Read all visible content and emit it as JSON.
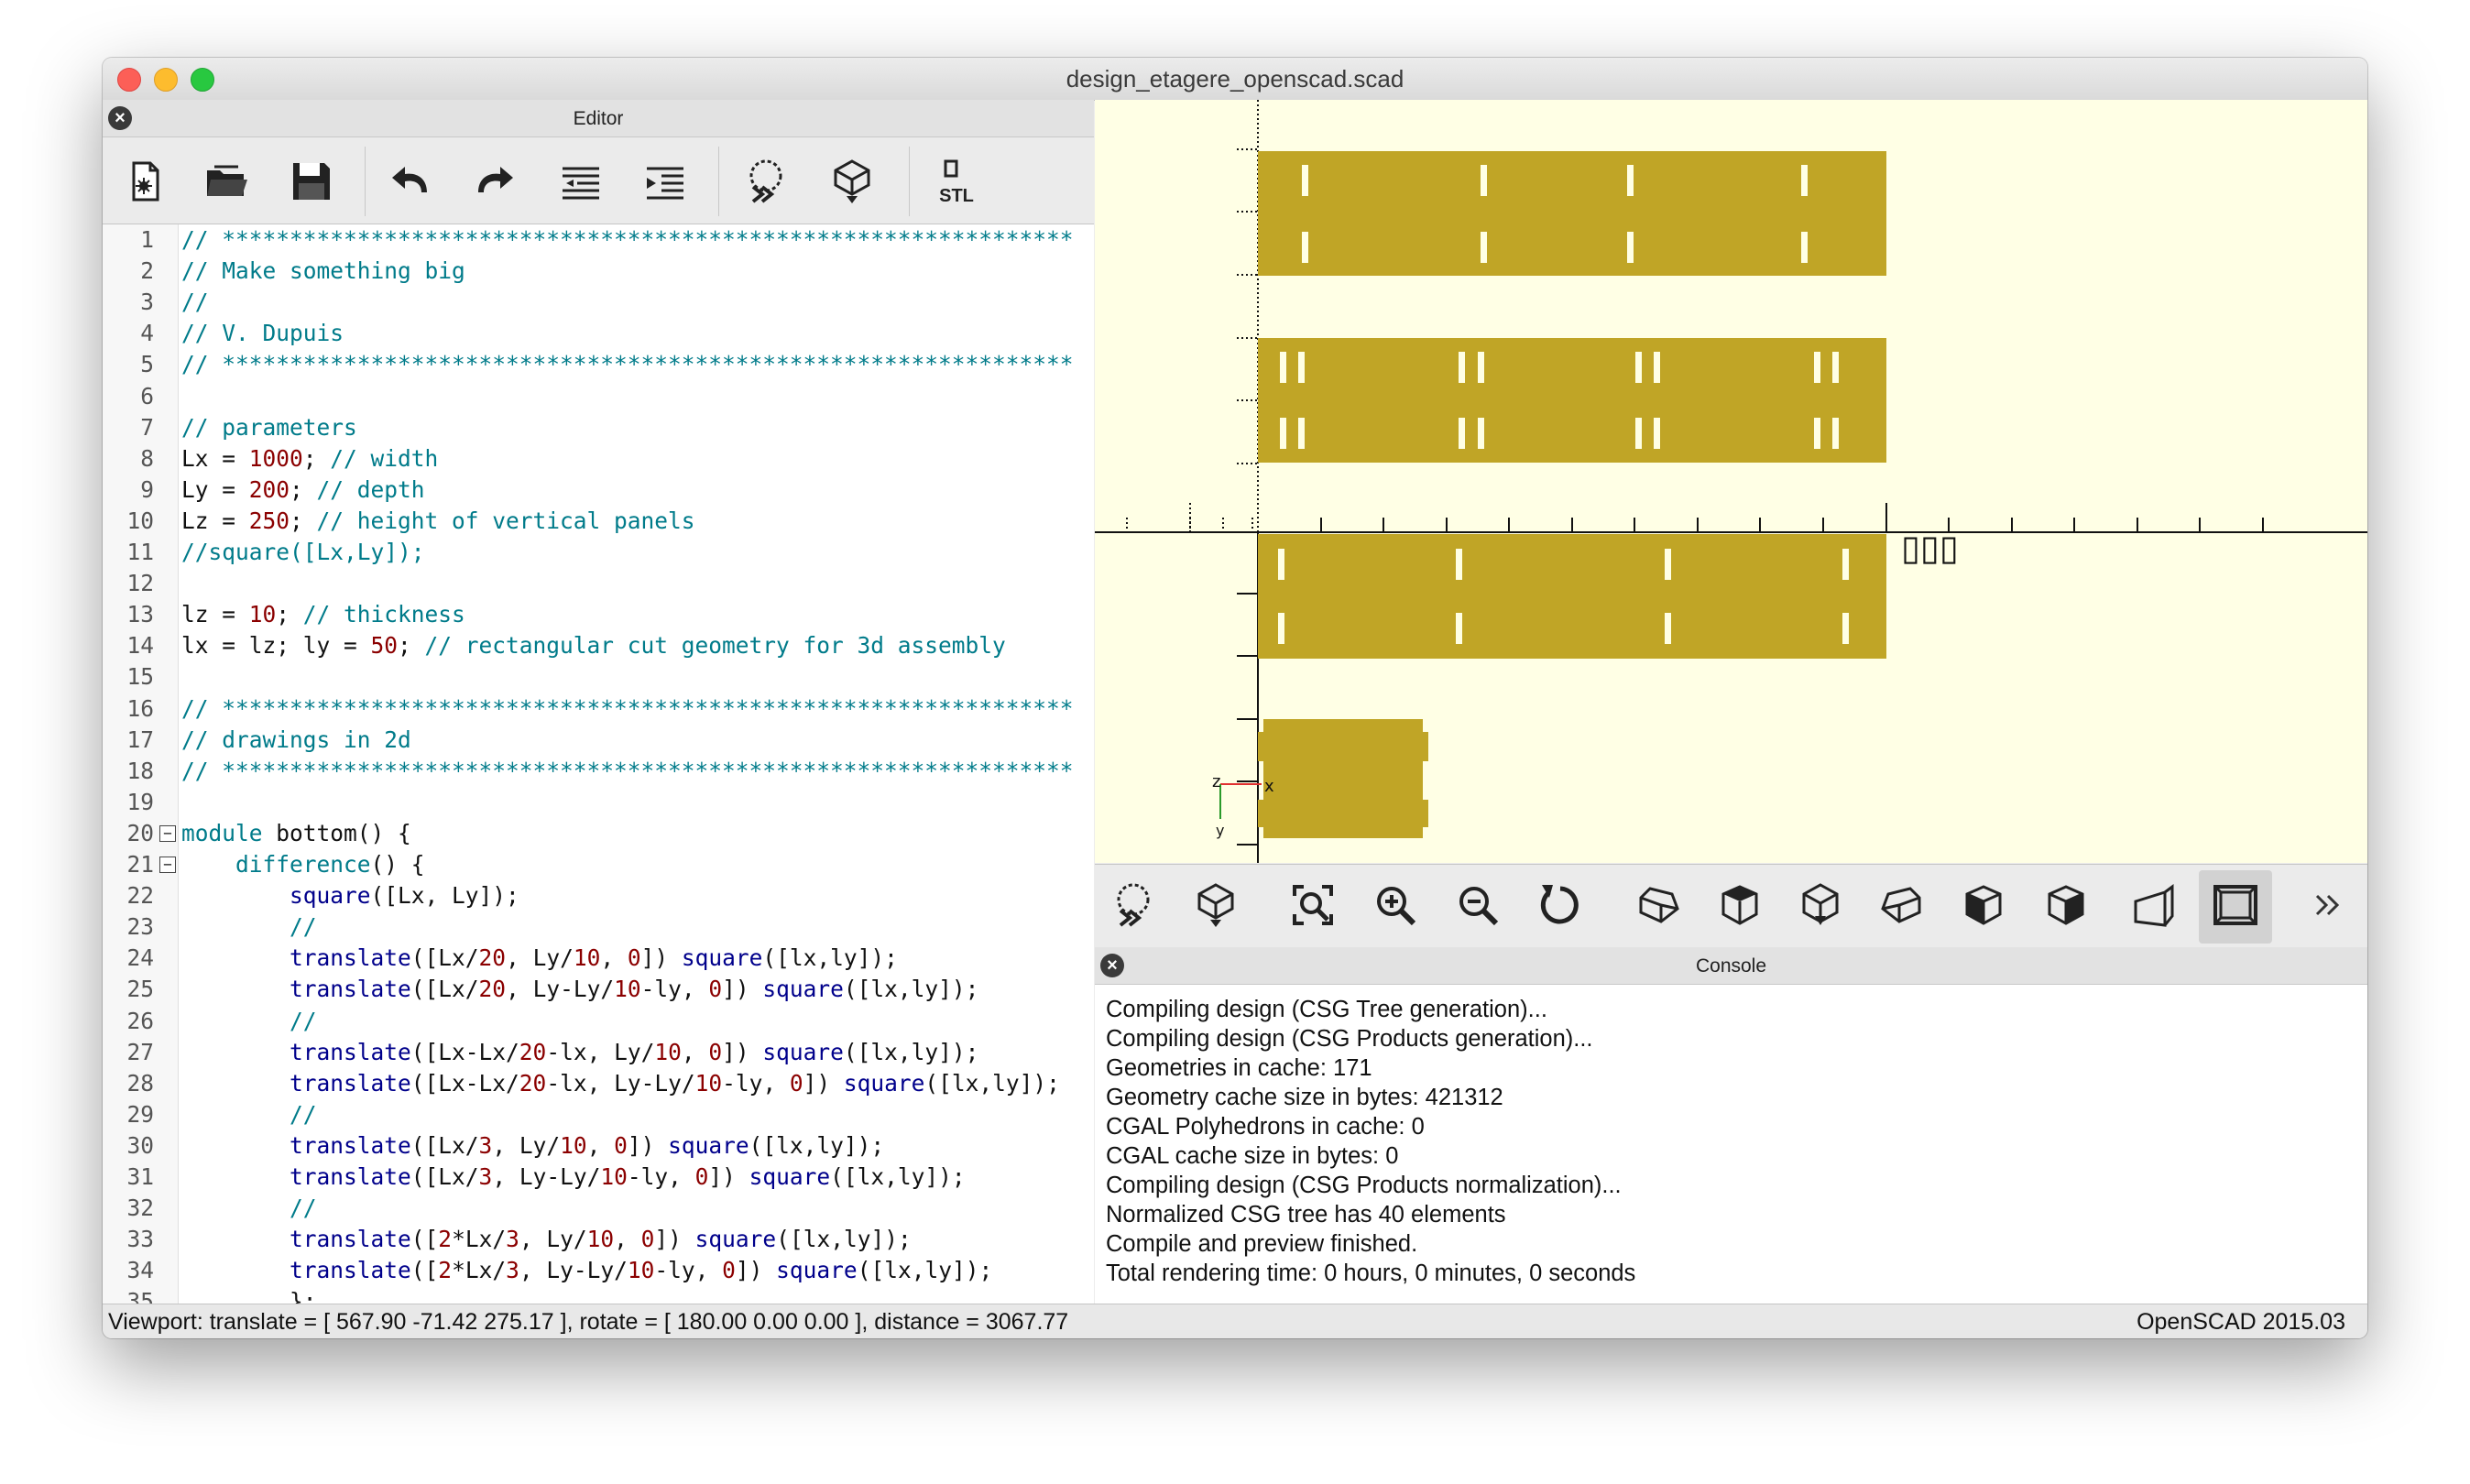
{
  "window": {
    "title": "design_etagere_openscad.scad"
  },
  "editor": {
    "title": "Editor",
    "toolbar": [
      "new-file-icon",
      "open-file-icon",
      "save-icon",
      "undo-icon",
      "redo-icon",
      "unindent-icon",
      "indent-icon",
      "preview-icon",
      "render-icon",
      "export-stl-icon"
    ],
    "stl_label": "STL",
    "lines": [
      {
        "n": "1",
        "parts": [
          [
            "com",
            "// ***************************************************************"
          ]
        ]
      },
      {
        "n": "2",
        "parts": [
          [
            "com",
            "// Make something big"
          ]
        ]
      },
      {
        "n": "3",
        "parts": [
          [
            "com",
            "//"
          ]
        ]
      },
      {
        "n": "4",
        "parts": [
          [
            "com",
            "// V. Dupuis"
          ]
        ]
      },
      {
        "n": "5",
        "parts": [
          [
            "com",
            "// ***************************************************************"
          ]
        ]
      },
      {
        "n": "6",
        "parts": []
      },
      {
        "n": "7",
        "parts": [
          [
            "com",
            "// parameters"
          ]
        ]
      },
      {
        "n": "8",
        "parts": [
          [
            "id",
            "Lx = "
          ],
          [
            "num",
            "1000"
          ],
          [
            "id",
            "; "
          ],
          [
            "com",
            "// width"
          ]
        ]
      },
      {
        "n": "9",
        "parts": [
          [
            "id",
            "Ly = "
          ],
          [
            "num",
            "200"
          ],
          [
            "id",
            "; "
          ],
          [
            "com",
            "// depth"
          ]
        ]
      },
      {
        "n": "10",
        "parts": [
          [
            "id",
            "Lz = "
          ],
          [
            "num",
            "250"
          ],
          [
            "id",
            "; "
          ],
          [
            "com",
            "// height of vertical panels"
          ]
        ]
      },
      {
        "n": "11",
        "parts": [
          [
            "com",
            "//square([Lx,Ly]);"
          ]
        ]
      },
      {
        "n": "12",
        "parts": []
      },
      {
        "n": "13",
        "parts": [
          [
            "id",
            "lz = "
          ],
          [
            "num",
            "10"
          ],
          [
            "id",
            "; "
          ],
          [
            "com",
            "// thickness"
          ]
        ]
      },
      {
        "n": "14",
        "parts": [
          [
            "id",
            "lx = lz; ly = "
          ],
          [
            "num",
            "50"
          ],
          [
            "id",
            "; "
          ],
          [
            "com",
            "// rectangular cut geometry for 3d assembly"
          ]
        ]
      },
      {
        "n": "15",
        "parts": []
      },
      {
        "n": "16",
        "parts": [
          [
            "com",
            "// ***************************************************************"
          ]
        ]
      },
      {
        "n": "17",
        "parts": [
          [
            "com",
            "// drawings in 2d"
          ]
        ]
      },
      {
        "n": "18",
        "parts": [
          [
            "com",
            "// ***************************************************************"
          ]
        ]
      },
      {
        "n": "19",
        "parts": []
      },
      {
        "n": "20",
        "fold": "−",
        "parts": [
          [
            "com",
            "module"
          ],
          [
            "id",
            " bottom() {"
          ]
        ]
      },
      {
        "n": "21",
        "fold": "−",
        "parts": [
          [
            "id",
            "    "
          ],
          [
            "com",
            "difference"
          ],
          [
            "id",
            "() {"
          ]
        ]
      },
      {
        "n": "22",
        "parts": [
          [
            "id",
            "        "
          ],
          [
            "fn",
            "square"
          ],
          [
            "id",
            "([Lx, Ly]);"
          ]
        ]
      },
      {
        "n": "23",
        "parts": [
          [
            "id",
            "        "
          ],
          [
            "com",
            "//"
          ]
        ]
      },
      {
        "n": "24",
        "parts": [
          [
            "id",
            "        "
          ],
          [
            "fn",
            "translate"
          ],
          [
            "id",
            "([Lx/"
          ],
          [
            "num",
            "20"
          ],
          [
            "id",
            ", Ly/"
          ],
          [
            "num",
            "10"
          ],
          [
            "id",
            ", "
          ],
          [
            "num",
            "0"
          ],
          [
            "id",
            "]) "
          ],
          [
            "fn",
            "square"
          ],
          [
            "id",
            "([lx,ly]);"
          ]
        ]
      },
      {
        "n": "25",
        "parts": [
          [
            "id",
            "        "
          ],
          [
            "fn",
            "translate"
          ],
          [
            "id",
            "([Lx/"
          ],
          [
            "num",
            "20"
          ],
          [
            "id",
            ", Ly-Ly/"
          ],
          [
            "num",
            "10"
          ],
          [
            "id",
            "-ly, "
          ],
          [
            "num",
            "0"
          ],
          [
            "id",
            "]) "
          ],
          [
            "fn",
            "square"
          ],
          [
            "id",
            "([lx,ly]);"
          ]
        ]
      },
      {
        "n": "26",
        "parts": [
          [
            "id",
            "        "
          ],
          [
            "com",
            "//"
          ]
        ]
      },
      {
        "n": "27",
        "parts": [
          [
            "id",
            "        "
          ],
          [
            "fn",
            "translate"
          ],
          [
            "id",
            "([Lx-Lx/"
          ],
          [
            "num",
            "20"
          ],
          [
            "id",
            "-lx, Ly/"
          ],
          [
            "num",
            "10"
          ],
          [
            "id",
            ", "
          ],
          [
            "num",
            "0"
          ],
          [
            "id",
            "]) "
          ],
          [
            "fn",
            "square"
          ],
          [
            "id",
            "([lx,ly]);"
          ]
        ]
      },
      {
        "n": "28",
        "parts": [
          [
            "id",
            "        "
          ],
          [
            "fn",
            "translate"
          ],
          [
            "id",
            "([Lx-Lx/"
          ],
          [
            "num",
            "20"
          ],
          [
            "id",
            "-lx, Ly-Ly/"
          ],
          [
            "num",
            "10"
          ],
          [
            "id",
            "-ly, "
          ],
          [
            "num",
            "0"
          ],
          [
            "id",
            "]) "
          ],
          [
            "fn",
            "square"
          ],
          [
            "id",
            "([lx,ly]);"
          ]
        ]
      },
      {
        "n": "29",
        "parts": [
          [
            "id",
            "        "
          ],
          [
            "com",
            "//"
          ]
        ]
      },
      {
        "n": "30",
        "parts": [
          [
            "id",
            "        "
          ],
          [
            "fn",
            "translate"
          ],
          [
            "id",
            "([Lx/"
          ],
          [
            "num",
            "3"
          ],
          [
            "id",
            ", Ly/"
          ],
          [
            "num",
            "10"
          ],
          [
            "id",
            ", "
          ],
          [
            "num",
            "0"
          ],
          [
            "id",
            "]) "
          ],
          [
            "fn",
            "square"
          ],
          [
            "id",
            "([lx,ly]);"
          ]
        ]
      },
      {
        "n": "31",
        "parts": [
          [
            "id",
            "        "
          ],
          [
            "fn",
            "translate"
          ],
          [
            "id",
            "([Lx/"
          ],
          [
            "num",
            "3"
          ],
          [
            "id",
            ", Ly-Ly/"
          ],
          [
            "num",
            "10"
          ],
          [
            "id",
            "-ly, "
          ],
          [
            "num",
            "0"
          ],
          [
            "id",
            "]) "
          ],
          [
            "fn",
            "square"
          ],
          [
            "id",
            "([lx,ly]);"
          ]
        ]
      },
      {
        "n": "32",
        "parts": [
          [
            "id",
            "        "
          ],
          [
            "com",
            "//"
          ]
        ]
      },
      {
        "n": "33",
        "parts": [
          [
            "id",
            "        "
          ],
          [
            "fn",
            "translate"
          ],
          [
            "id",
            "(["
          ],
          [
            "num",
            "2"
          ],
          [
            "id",
            "*Lx/"
          ],
          [
            "num",
            "3"
          ],
          [
            "id",
            ", Ly/"
          ],
          [
            "num",
            "10"
          ],
          [
            "id",
            ", "
          ],
          [
            "num",
            "0"
          ],
          [
            "id",
            "]) "
          ],
          [
            "fn",
            "square"
          ],
          [
            "id",
            "([lx,ly]);"
          ]
        ]
      },
      {
        "n": "34",
        "parts": [
          [
            "id",
            "        "
          ],
          [
            "fn",
            "translate"
          ],
          [
            "id",
            "(["
          ],
          [
            "num",
            "2"
          ],
          [
            "id",
            "*Lx/"
          ],
          [
            "num",
            "3"
          ],
          [
            "id",
            ", Ly-Ly/"
          ],
          [
            "num",
            "10"
          ],
          [
            "id",
            "-ly, "
          ],
          [
            "num",
            "0"
          ],
          [
            "id",
            "]) "
          ],
          [
            "fn",
            "square"
          ],
          [
            "id",
            "([lx,ly]);"
          ]
        ]
      },
      {
        "n": "35",
        "parts": [
          [
            "id",
            "        };"
          ]
        ]
      }
    ]
  },
  "viewport": {
    "toolbar": [
      "preview-icon",
      "render-icon",
      "view-all-icon",
      "zoom-in-icon",
      "zoom-out-icon",
      "reset-view-icon",
      "view-right-icon",
      "view-top-icon",
      "view-bottom-icon",
      "view-left-icon",
      "view-front-icon",
      "view-back-icon",
      "perspective-icon",
      "orthogonal-icon",
      "more-icon"
    ],
    "axis_labels": {
      "z": "z",
      "x": "x",
      "y": "y"
    },
    "missing_glyphs": "▯▯▯",
    "model_color": "#c0a526"
  },
  "console": {
    "title": "Console",
    "lines": [
      "Compiling design (CSG Tree generation)...",
      "Compiling design (CSG Products generation)...",
      "Geometries in cache: 171",
      "Geometry cache size in bytes: 421312",
      "CGAL Polyhedrons in cache: 0",
      "CGAL cache size in bytes: 0",
      "Compiling design (CSG Products normalization)...",
      "Normalized CSG tree has 40 elements",
      "Compile and preview finished.",
      "Total rendering time: 0 hours, 0 minutes, 0 seconds"
    ]
  },
  "status": {
    "left": "Viewport: translate = [ 567.90 -71.42 275.17 ], rotate = [ 180.00 0.00 0.00 ], distance = 3067.77",
    "right": "OpenSCAD 2015.03"
  }
}
